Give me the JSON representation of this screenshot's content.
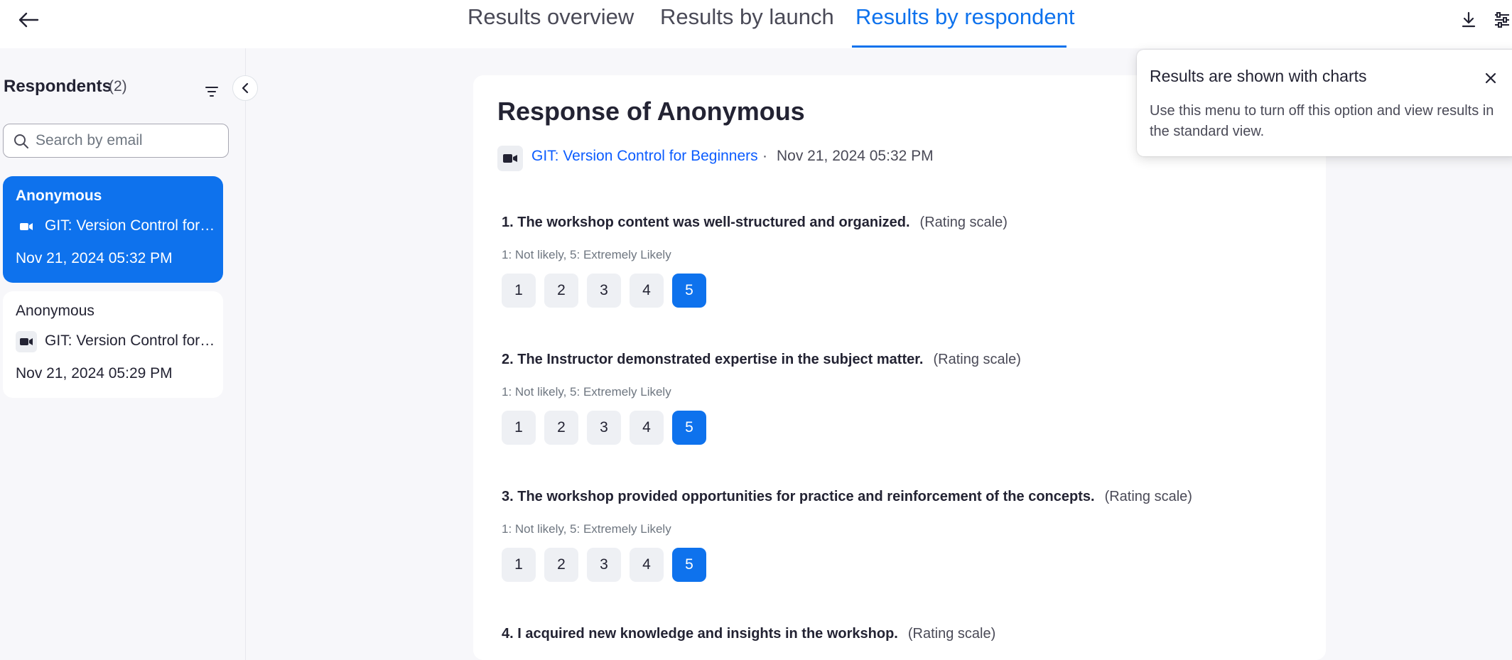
{
  "tabs": [
    {
      "label": "Results overview"
    },
    {
      "label": "Results by launch"
    },
    {
      "label": "Results by respondent"
    }
  ],
  "sidebar": {
    "title": "Respondents",
    "count": "(2)",
    "search_placeholder": "Search by email",
    "respondents": [
      {
        "name": "Anonymous",
        "event": "GIT: Version Control for Beginners",
        "date": "Nov 21, 2024 05:32 PM",
        "selected": true
      },
      {
        "name": "Anonymous",
        "event": "GIT: Version Control for Beginners",
        "date": "Nov 21, 2024 05:29 PM",
        "selected": false
      }
    ]
  },
  "response": {
    "title": "Response of Anonymous",
    "event": "GIT: Version Control for Beginners",
    "separator": "·",
    "date": "Nov 21, 2024 05:32 PM",
    "questions": [
      {
        "text": "1. The workshop content was well-structured and organized.",
        "type": "(Rating scale)",
        "scale": "1: Not likely, 5: Extremely Likely",
        "options": [
          "1",
          "2",
          "3",
          "4",
          "5"
        ],
        "selected": "5"
      },
      {
        "text": "2. The Instructor demonstrated expertise in the subject matter.",
        "type": "(Rating scale)",
        "scale": "1: Not likely, 5: Extremely Likely",
        "options": [
          "1",
          "2",
          "3",
          "4",
          "5"
        ],
        "selected": "5"
      },
      {
        "text": "3. The workshop provided opportunities for practice and reinforcement of the concepts.",
        "type": "(Rating scale)",
        "scale": "1: Not likely, 5: Extremely Likely",
        "options": [
          "1",
          "2",
          "3",
          "4",
          "5"
        ],
        "selected": "5"
      },
      {
        "text": "4. I acquired new knowledge and insights in the workshop.",
        "type": "(Rating scale)"
      }
    ]
  },
  "popover": {
    "title": "Results are shown with charts",
    "body": "Use this menu to turn off this option and view results in the standard view."
  },
  "colors": {
    "accent": "#0e72ed",
    "link": "#0b5cff"
  }
}
